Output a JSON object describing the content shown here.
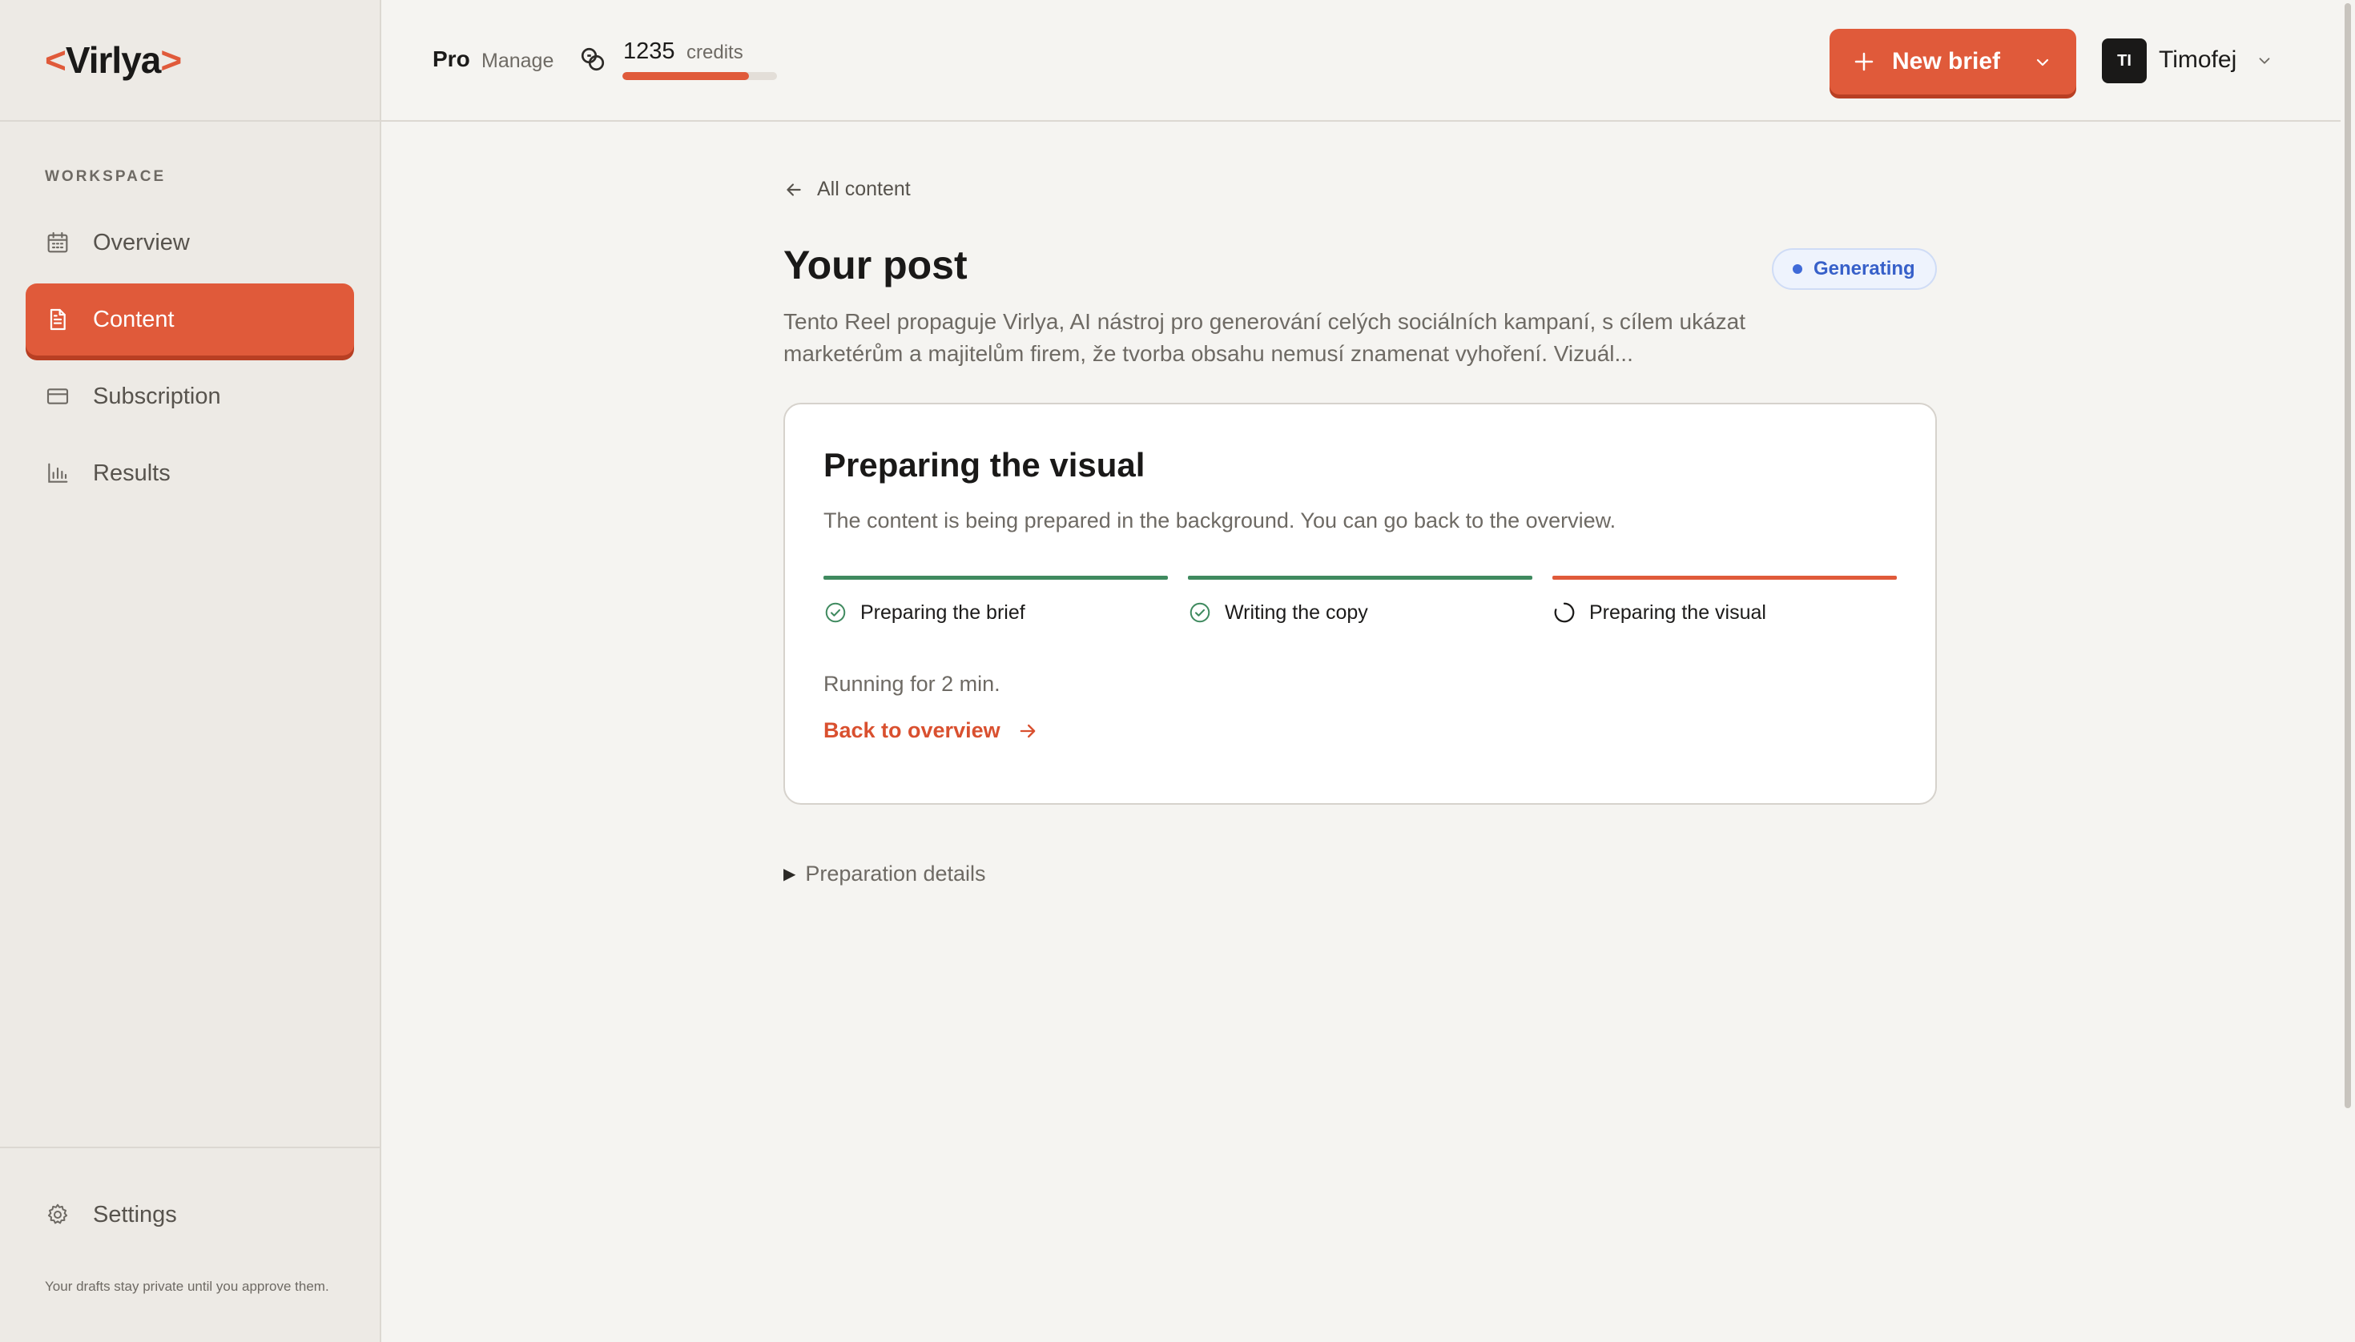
{
  "brand": {
    "open": "<",
    "name": "Virlya",
    "close": ">"
  },
  "sidebar": {
    "section_label": "WORKSPACE",
    "items": [
      {
        "label": "Overview",
        "icon": "calendar-icon",
        "active": false
      },
      {
        "label": "Content",
        "icon": "document-icon",
        "active": true
      },
      {
        "label": "Subscription",
        "icon": "credit-card-icon",
        "active": false
      },
      {
        "label": "Results",
        "icon": "bar-chart-icon",
        "active": false
      }
    ],
    "settings_label": "Settings",
    "privacy_note": "Your drafts stay private until you approve them."
  },
  "topbar": {
    "plan": "Pro",
    "manage_label": "Manage",
    "credits": "1235",
    "credits_label": "credits",
    "credits_fill_fraction": 0.82,
    "new_brief_label": "New brief",
    "user_initials": "TI",
    "user_name": "Timofej"
  },
  "main": {
    "back_label": "All content",
    "title": "Your post",
    "status": "Generating",
    "description": "Tento Reel propaguje Virlya, AI nástroj pro generování celých sociálních kampaní, s cílem ukázat marketérům a majitelům firem, že tvorba obsahu nemusí znamenat vyhoření. Vizuál...",
    "card": {
      "title": "Preparing the visual",
      "subtitle": "The content is being prepared in the background. You can go back to the overview.",
      "steps": [
        {
          "label": "Preparing the brief",
          "state": "done"
        },
        {
          "label": "Writing the copy",
          "state": "done"
        },
        {
          "label": "Preparing the visual",
          "state": "in-progress"
        }
      ],
      "running": "Running for 2 min.",
      "overview_link": "Back to overview"
    },
    "details_label": "Preparation details"
  },
  "colors": {
    "accent": "#e05a3a",
    "done": "#3f8a5f",
    "status_blue": "#3760c9",
    "background": "#f5f4f1",
    "sidebar": "#edeae5"
  }
}
